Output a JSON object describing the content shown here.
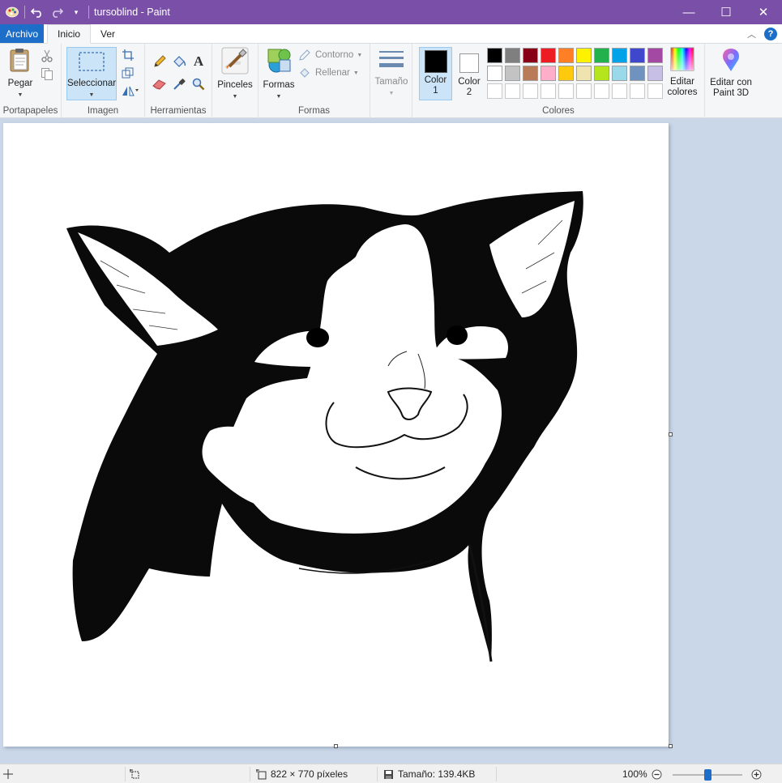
{
  "window": {
    "title": "tursoblind - Paint",
    "minimize": "—",
    "maximize": "☐",
    "close": "✕"
  },
  "tabs": {
    "file": "Archivo",
    "home": "Inicio",
    "view": "Ver",
    "help": "?"
  },
  "ribbon": {
    "clipboard": {
      "paste": "Pegar",
      "group": "Portapapeles"
    },
    "image": {
      "select": "Seleccionar",
      "group": "Imagen"
    },
    "tools": {
      "group": "Herramientas",
      "text_glyph": "A"
    },
    "brushes": {
      "label": "Pinceles"
    },
    "shapes": {
      "label": "Formas",
      "outline": "Contorno",
      "fill": "Rellenar",
      "group": "Formas"
    },
    "size": {
      "label": "Tamaño"
    },
    "colors": {
      "color1": "Color 1",
      "color2": "Color 2",
      "color1_value": "#000000",
      "color2_value": "#ffffff",
      "edit": "Editar colores",
      "group": "Colores",
      "palette_row1": [
        "#000000",
        "#7f7f7f",
        "#880015",
        "#ed1c24",
        "#ff7f27",
        "#fff200",
        "#22b14c",
        "#00a2e8",
        "#3f48cc",
        "#a349a4"
      ],
      "palette_row2": [
        "#ffffff",
        "#c3c3c3",
        "#b97a57",
        "#ffaec9",
        "#ffc90e",
        "#efe4b0",
        "#b5e61d",
        "#99d9ea",
        "#7092be",
        "#c8bfe7"
      ]
    },
    "paint3d": {
      "label": "Editar con Paint 3D"
    }
  },
  "status": {
    "dimensions": "822 × 770 píxeles",
    "size": "Tamaño: 139.4KB",
    "zoom": "100%",
    "zoom_level": 0.5
  },
  "icons": {
    "app": "paint-app-icon",
    "undo": "undo-icon",
    "redo": "redo-icon"
  }
}
